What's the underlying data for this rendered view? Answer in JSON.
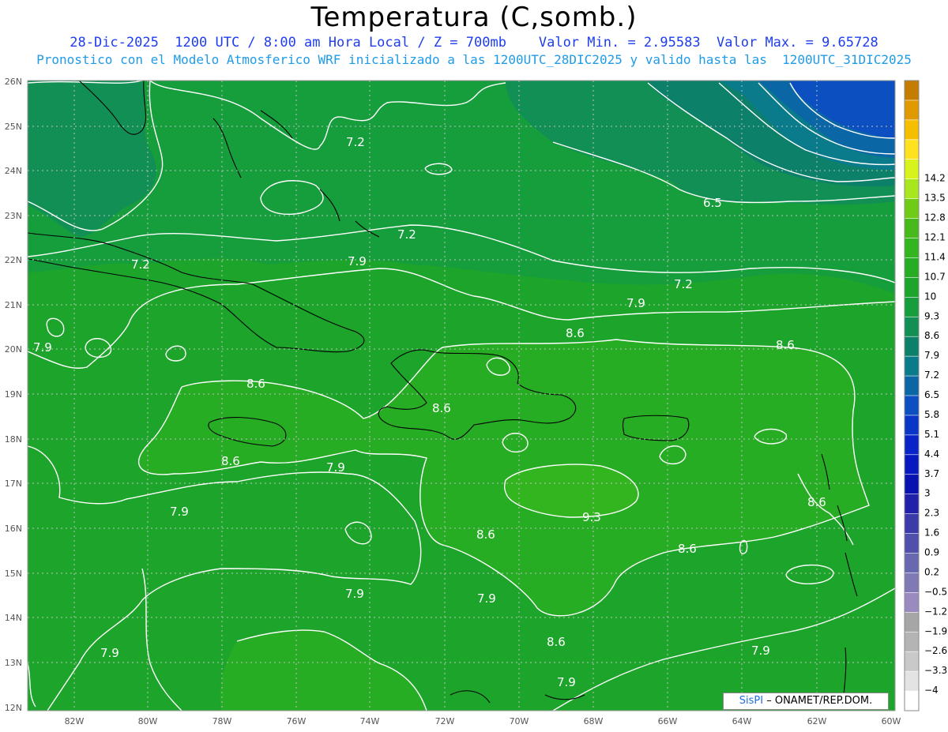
{
  "header": {
    "title": "Temperatura (C,somb.)",
    "subtitle_line1": "28-Dic-2025  1200 UTC / 8:00 am Hora Local / Z = 700mb    Valor Min. = 2.95583  Valor Max. = 9.65728",
    "subtitle_line2": "Pronostico con el Modelo Atmosferico WRF inicializado a las 1200UTC_28DIC2025 y valido hasta las  1200UTC_31DIC2025"
  },
  "map": {
    "lat_labels": [
      "26N",
      "25N",
      "24N",
      "23N",
      "22N",
      "21N",
      "20N",
      "19N",
      "18N",
      "17N",
      "16N",
      "15N",
      "14N",
      "13N",
      "12N"
    ],
    "lon_labels": [
      "82W",
      "80W",
      "78W",
      "76W",
      "74W",
      "72W",
      "70W",
      "68W",
      "66W",
      "64W",
      "62W",
      "60W"
    ],
    "contour_labels": [
      {
        "id": "c1",
        "text": "7.2"
      },
      {
        "id": "c2",
        "text": "7.2"
      },
      {
        "id": "c3",
        "text": "7.2"
      },
      {
        "id": "c4",
        "text": "6.5"
      },
      {
        "id": "c5",
        "text": "7.9"
      },
      {
        "id": "c6",
        "text": "7.2"
      },
      {
        "id": "c7",
        "text": "7.9"
      },
      {
        "id": "c8",
        "text": "7.9"
      },
      {
        "id": "c9",
        "text": "8.6"
      },
      {
        "id": "c10",
        "text": "8.6"
      },
      {
        "id": "c11",
        "text": "8.6"
      },
      {
        "id": "c12",
        "text": "8.6"
      },
      {
        "id": "c13",
        "text": "8.6"
      },
      {
        "id": "c14",
        "text": "7.9"
      },
      {
        "id": "c15",
        "text": "7.9"
      },
      {
        "id": "c16",
        "text": "9.3"
      },
      {
        "id": "c17",
        "text": "8.6"
      },
      {
        "id": "c18",
        "text": "8.6"
      },
      {
        "id": "c19",
        "text": "8.6"
      },
      {
        "id": "c20",
        "text": "7.9"
      },
      {
        "id": "c21",
        "text": "7.9"
      },
      {
        "id": "c22",
        "text": "7.9"
      },
      {
        "id": "c23",
        "text": "8.6"
      },
      {
        "id": "c24",
        "text": "7.9"
      },
      {
        "id": "c25",
        "text": "7.9"
      }
    ]
  },
  "colorbar": {
    "colors": [
      "#c47d00",
      "#e09a00",
      "#f5bf00",
      "#ffe21f",
      "#d8f21c",
      "#a8e61d",
      "#6fcb16",
      "#47b91b",
      "#33b51f",
      "#27ad24",
      "#1da42a",
      "#169d3c",
      "#118f55",
      "#0c8068",
      "#0a7b8a",
      "#0b66a6",
      "#0c4fc0",
      "#0a36c8",
      "#0824c8",
      "#0718c0",
      "#0712b0",
      "#2020a8",
      "#3a3aa8",
      "#5050ac",
      "#6868b0",
      "#7f7ab5",
      "#9a8ac0",
      "#a6a6a6",
      "#b4b4b4",
      "#c9c9c9",
      "#e3e3e3",
      "#ffffff"
    ],
    "labels": [
      "14.2",
      "13.5",
      "12.8",
      "12.1",
      "11.4",
      "10.7",
      "10",
      "9.3",
      "8.6",
      "7.9",
      "7.2",
      "6.5",
      "5.8",
      "5.1",
      "4.4",
      "3.7",
      "3",
      "2.3",
      "1.6",
      "0.9",
      "0.2",
      "−0.5",
      "−1.2",
      "−1.9",
      "−2.6",
      "−3.3",
      "−4"
    ]
  },
  "credit": {
    "brand": "SisPI",
    "text": " – ONAMET/REP.DOM."
  }
}
